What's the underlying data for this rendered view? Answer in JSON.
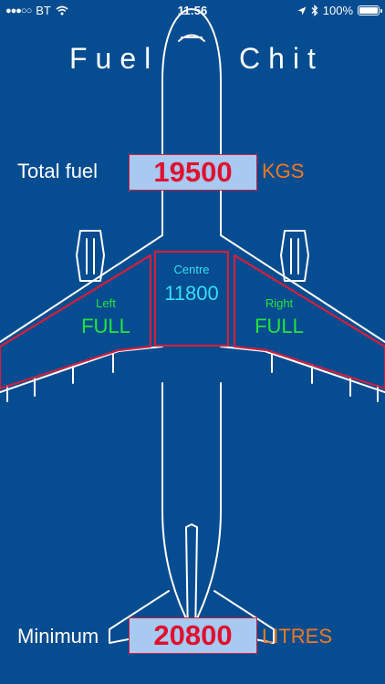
{
  "status": {
    "carrier": "BT",
    "time": "11:56",
    "battery": "100%",
    "battery_level": 1.0,
    "icons": [
      "signal-dots-icon",
      "wifi-icon",
      "location-arrow-icon",
      "bluetooth-icon",
      "battery-icon"
    ]
  },
  "title": {
    "word1": "Fuel",
    "word2": "Chit"
  },
  "total": {
    "label": "Total fuel",
    "value": "19500",
    "unit": "KGS"
  },
  "tanks": {
    "left": {
      "label": "Left",
      "value": "FULL"
    },
    "centre": {
      "label": "Centre",
      "value": "11800"
    },
    "right": {
      "label": "Right",
      "value": "FULL"
    }
  },
  "minimum": {
    "label": "Minimum",
    "value": "20800",
    "unit": "LITRES"
  },
  "colors": {
    "background": "#064c91",
    "outline": "#ffffff",
    "tank_border": "#d21f3c",
    "value_box": "#a7c9f2",
    "value_text": "#e0102e",
    "unit_text": "#f07a1e",
    "tank_side_text": "#22e43a",
    "tank_centre_text": "#33dff2"
  }
}
